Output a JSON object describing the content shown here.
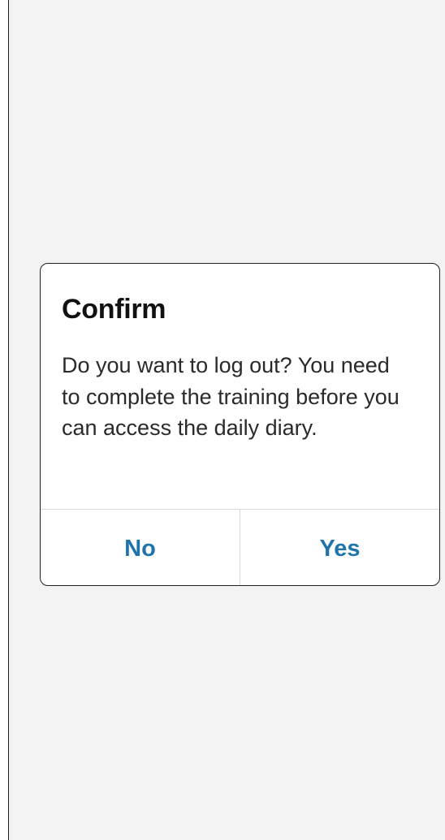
{
  "dialog": {
    "title": "Confirm",
    "message": "Do you want to log out? You need to complete the training before you can access the daily diary.",
    "buttons": {
      "no_label": "No",
      "yes_label": "Yes"
    }
  },
  "colors": {
    "background": "#f3f3f3",
    "dialog_background": "#ffffff",
    "action_text": "#1f74ad",
    "border": "#1f1f1f",
    "divider": "#d8d8d8"
  }
}
